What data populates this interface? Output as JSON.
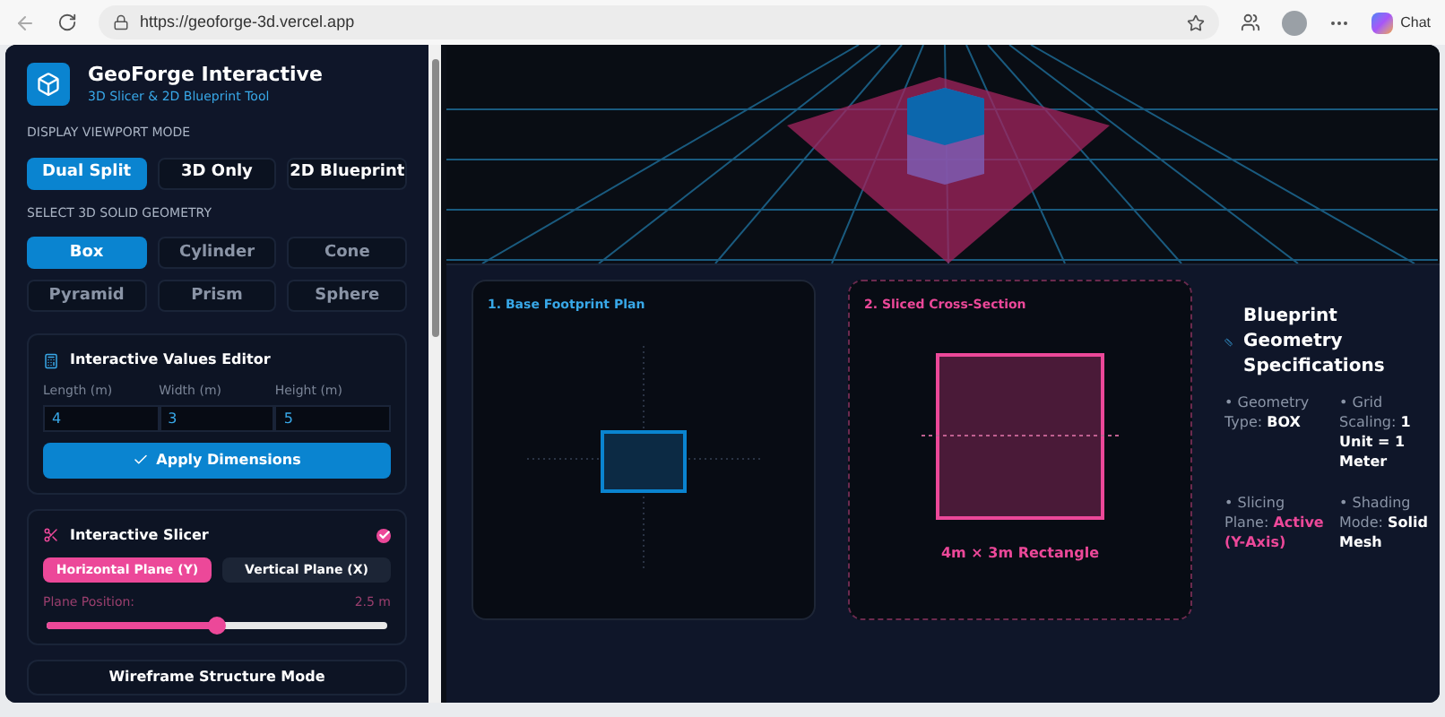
{
  "browser": {
    "url": "https://geoforge-3d.vercel.app",
    "chat_label": "Chat"
  },
  "app": {
    "title": "GeoForge Interactive",
    "subtitle": "3D Slicer & 2D Blueprint Tool"
  },
  "viewport_mode": {
    "label": "DISPLAY VIEWPORT MODE",
    "options": [
      {
        "label": "Dual Split",
        "selected": true
      },
      {
        "label": "3D Only",
        "selected": false
      },
      {
        "label": "2D Blueprint",
        "selected": false
      }
    ]
  },
  "geometry": {
    "label": "SELECT 3D SOLID GEOMETRY",
    "options": [
      {
        "label": "Box",
        "selected": true
      },
      {
        "label": "Cylinder",
        "selected": false
      },
      {
        "label": "Cone",
        "selected": false
      },
      {
        "label": "Pyramid",
        "selected": false
      },
      {
        "label": "Prism",
        "selected": false
      },
      {
        "label": "Sphere",
        "selected": false
      }
    ]
  },
  "editor": {
    "title": "Interactive Values Editor",
    "fields": [
      {
        "label": "Length (m)",
        "value": "4"
      },
      {
        "label": "Width (m)",
        "value": "3"
      },
      {
        "label": "Height (m)",
        "value": "5"
      }
    ],
    "apply_label": "Apply Dimensions"
  },
  "slicer": {
    "title": "Interactive Slicer",
    "enabled": true,
    "planes": [
      {
        "label": "Horizontal Plane (Y)",
        "selected": true
      },
      {
        "label": "Vertical Plane (X)",
        "selected": false
      }
    ],
    "position_label": "Plane Position:",
    "position_reading": "2.5 m",
    "level": 0.5
  },
  "wireframe": {
    "label": "Wireframe Structure Mode"
  },
  "plans": [
    {
      "kind": "footprint",
      "title": "1. Base Footprint Plan"
    },
    {
      "kind": "section",
      "title": "2. Sliced Cross-Section",
      "caption": "4m × 3m Rectangle"
    }
  ],
  "specs": {
    "title": "Blueprint Geometry Specifications",
    "items": [
      {
        "label": "• Geometry Type:",
        "value": "BOX",
        "kind": "plain"
      },
      {
        "label": "• Grid Scaling:",
        "value": "1 Unit = 1 Meter",
        "kind": "plain"
      },
      {
        "label": "• Slicing Plane:",
        "value": "Active (Y-Axis)",
        "kind": "accent"
      },
      {
        "label": "• Shading Mode:",
        "value": "Solid Mesh",
        "kind": "plain"
      }
    ]
  }
}
